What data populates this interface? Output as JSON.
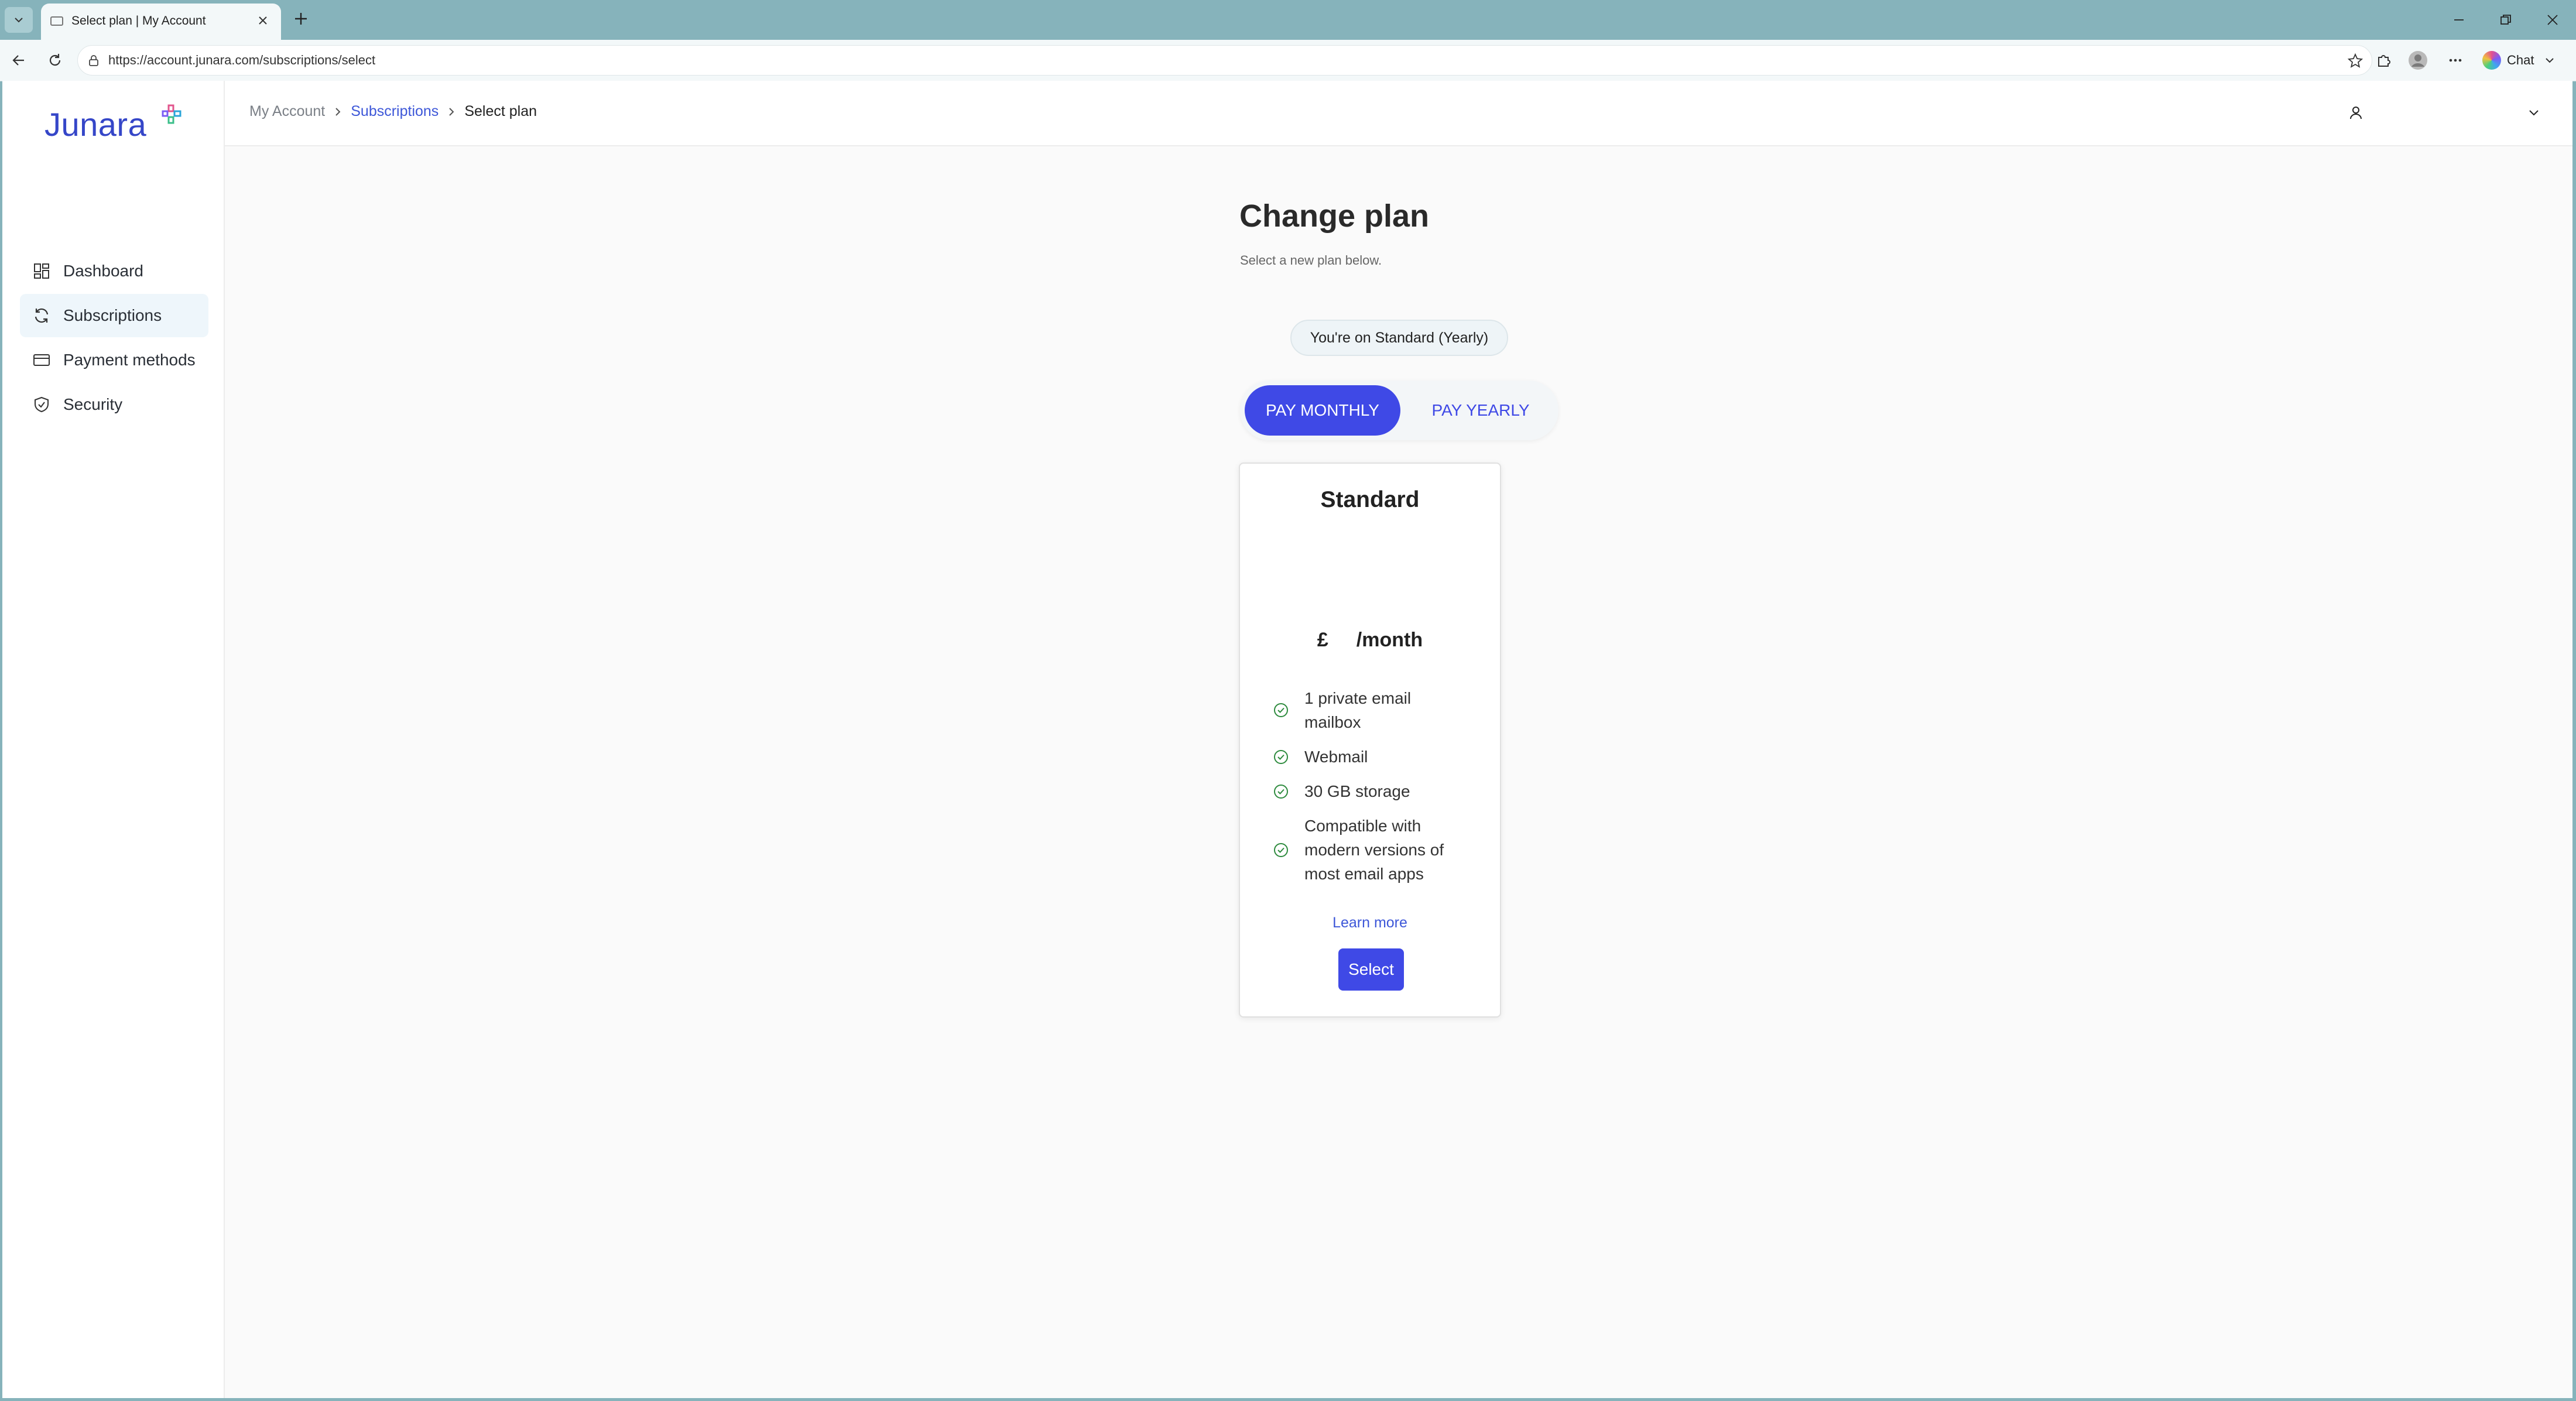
{
  "browser": {
    "tab_title": "Select plan | My Account",
    "url": "https://account.junara.com/subscriptions/select",
    "chat_label": "Chat"
  },
  "brand": {
    "name": "Junara",
    "accent": "#3f49e6",
    "logo_color": "#3546c8"
  },
  "sidebar": {
    "items": [
      {
        "label": "Dashboard",
        "icon": "dashboard-icon"
      },
      {
        "label": "Subscriptions",
        "icon": "refresh-icon",
        "active": true
      },
      {
        "label": "Payment methods",
        "icon": "credit-card-icon"
      },
      {
        "label": "Security",
        "icon": "shield-icon"
      }
    ]
  },
  "breadcrumb": {
    "root": "My Account",
    "section": "Subscriptions",
    "current": "Select plan"
  },
  "main": {
    "title": "Change plan",
    "subtitle": "Select a new plan below.",
    "current_plan": "You're on Standard (Yearly)",
    "toggle": {
      "monthly": "PAY MONTHLY",
      "yearly": "PAY YEARLY",
      "selected": "monthly"
    }
  },
  "plan": {
    "name": "Standard",
    "currency": "£",
    "period": "/month",
    "features": [
      "1 private email mailbox",
      "Webmail",
      "30 GB storage",
      "Compatible with modern versions of most email apps"
    ],
    "learn_more": "Learn more",
    "select_label": "Select"
  }
}
